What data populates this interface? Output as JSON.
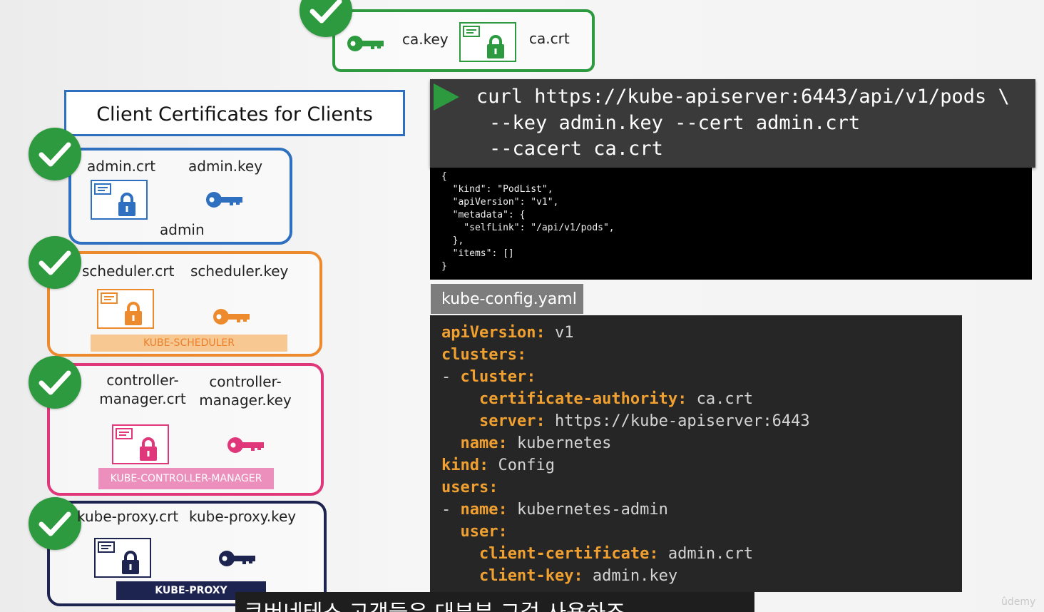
{
  "ca": {
    "key_label": "ca.key",
    "crt_label": "ca.crt",
    "color": "#2e9a3f"
  },
  "title": "Client Certificates for Clients",
  "clients": [
    {
      "crt": "admin.crt",
      "key": "admin.key",
      "name": "admin",
      "color": "#2f6fc0"
    },
    {
      "crt": "scheduler.crt",
      "key": "scheduler.key",
      "strip": "KUBE-SCHEDULER",
      "color": "#ee8a2e"
    },
    {
      "crt": "controller-\nmanager.crt",
      "key": "controller-\nmanager.key",
      "strip": "KUBE-CONTROLLER-MANAGER",
      "color": "#e0367a"
    },
    {
      "crt": "kube-proxy.crt",
      "key": "kube-proxy.key",
      "strip": "KUBE-PROXY",
      "color": "#1e2450"
    }
  ],
  "curl": {
    "line1": "curl https://kube-apiserver:6443/api/v1/pods \\",
    "line2": "--key admin.key --cert admin.crt",
    "line3": "--cacert ca.crt"
  },
  "response": "{\n  \"kind\": \"PodList\",\n  \"apiVersion\": \"v1\",\n  \"metadata\": {\n    \"selfLink\": \"/api/v1/pods\",\n  },\n  \"items\": []\n}",
  "kubeconfig": {
    "tab": "kube-config.yaml",
    "lines": [
      {
        "indent": "",
        "key": "apiVersion:",
        "value": " v1"
      },
      {
        "indent": "",
        "key": "clusters:",
        "value": ""
      },
      {
        "indent": "- ",
        "key": "cluster:",
        "value": ""
      },
      {
        "indent": "    ",
        "key": "certificate-authority:",
        "value": " ca.crt"
      },
      {
        "indent": "    ",
        "key": "server:",
        "value": " https://kube-apiserver:6443"
      },
      {
        "indent": "  ",
        "key": "name:",
        "value": " kubernetes"
      },
      {
        "indent": "",
        "key": "kind:",
        "value": " Config"
      },
      {
        "indent": "",
        "key": "users:",
        "value": ""
      },
      {
        "indent": "- ",
        "key": "name:",
        "value": " kubernetes-admin"
      },
      {
        "indent": "  ",
        "key": "user:",
        "value": ""
      },
      {
        "indent": "    ",
        "key": "client-certificate:",
        "value": " admin.crt"
      },
      {
        "indent": "    ",
        "key": "client-key:",
        "value": " admin.key"
      }
    ]
  },
  "subtitle": "쿠버네테스 고객들은 대부분 그걸 사용하죠",
  "watermark": "ûdemy"
}
